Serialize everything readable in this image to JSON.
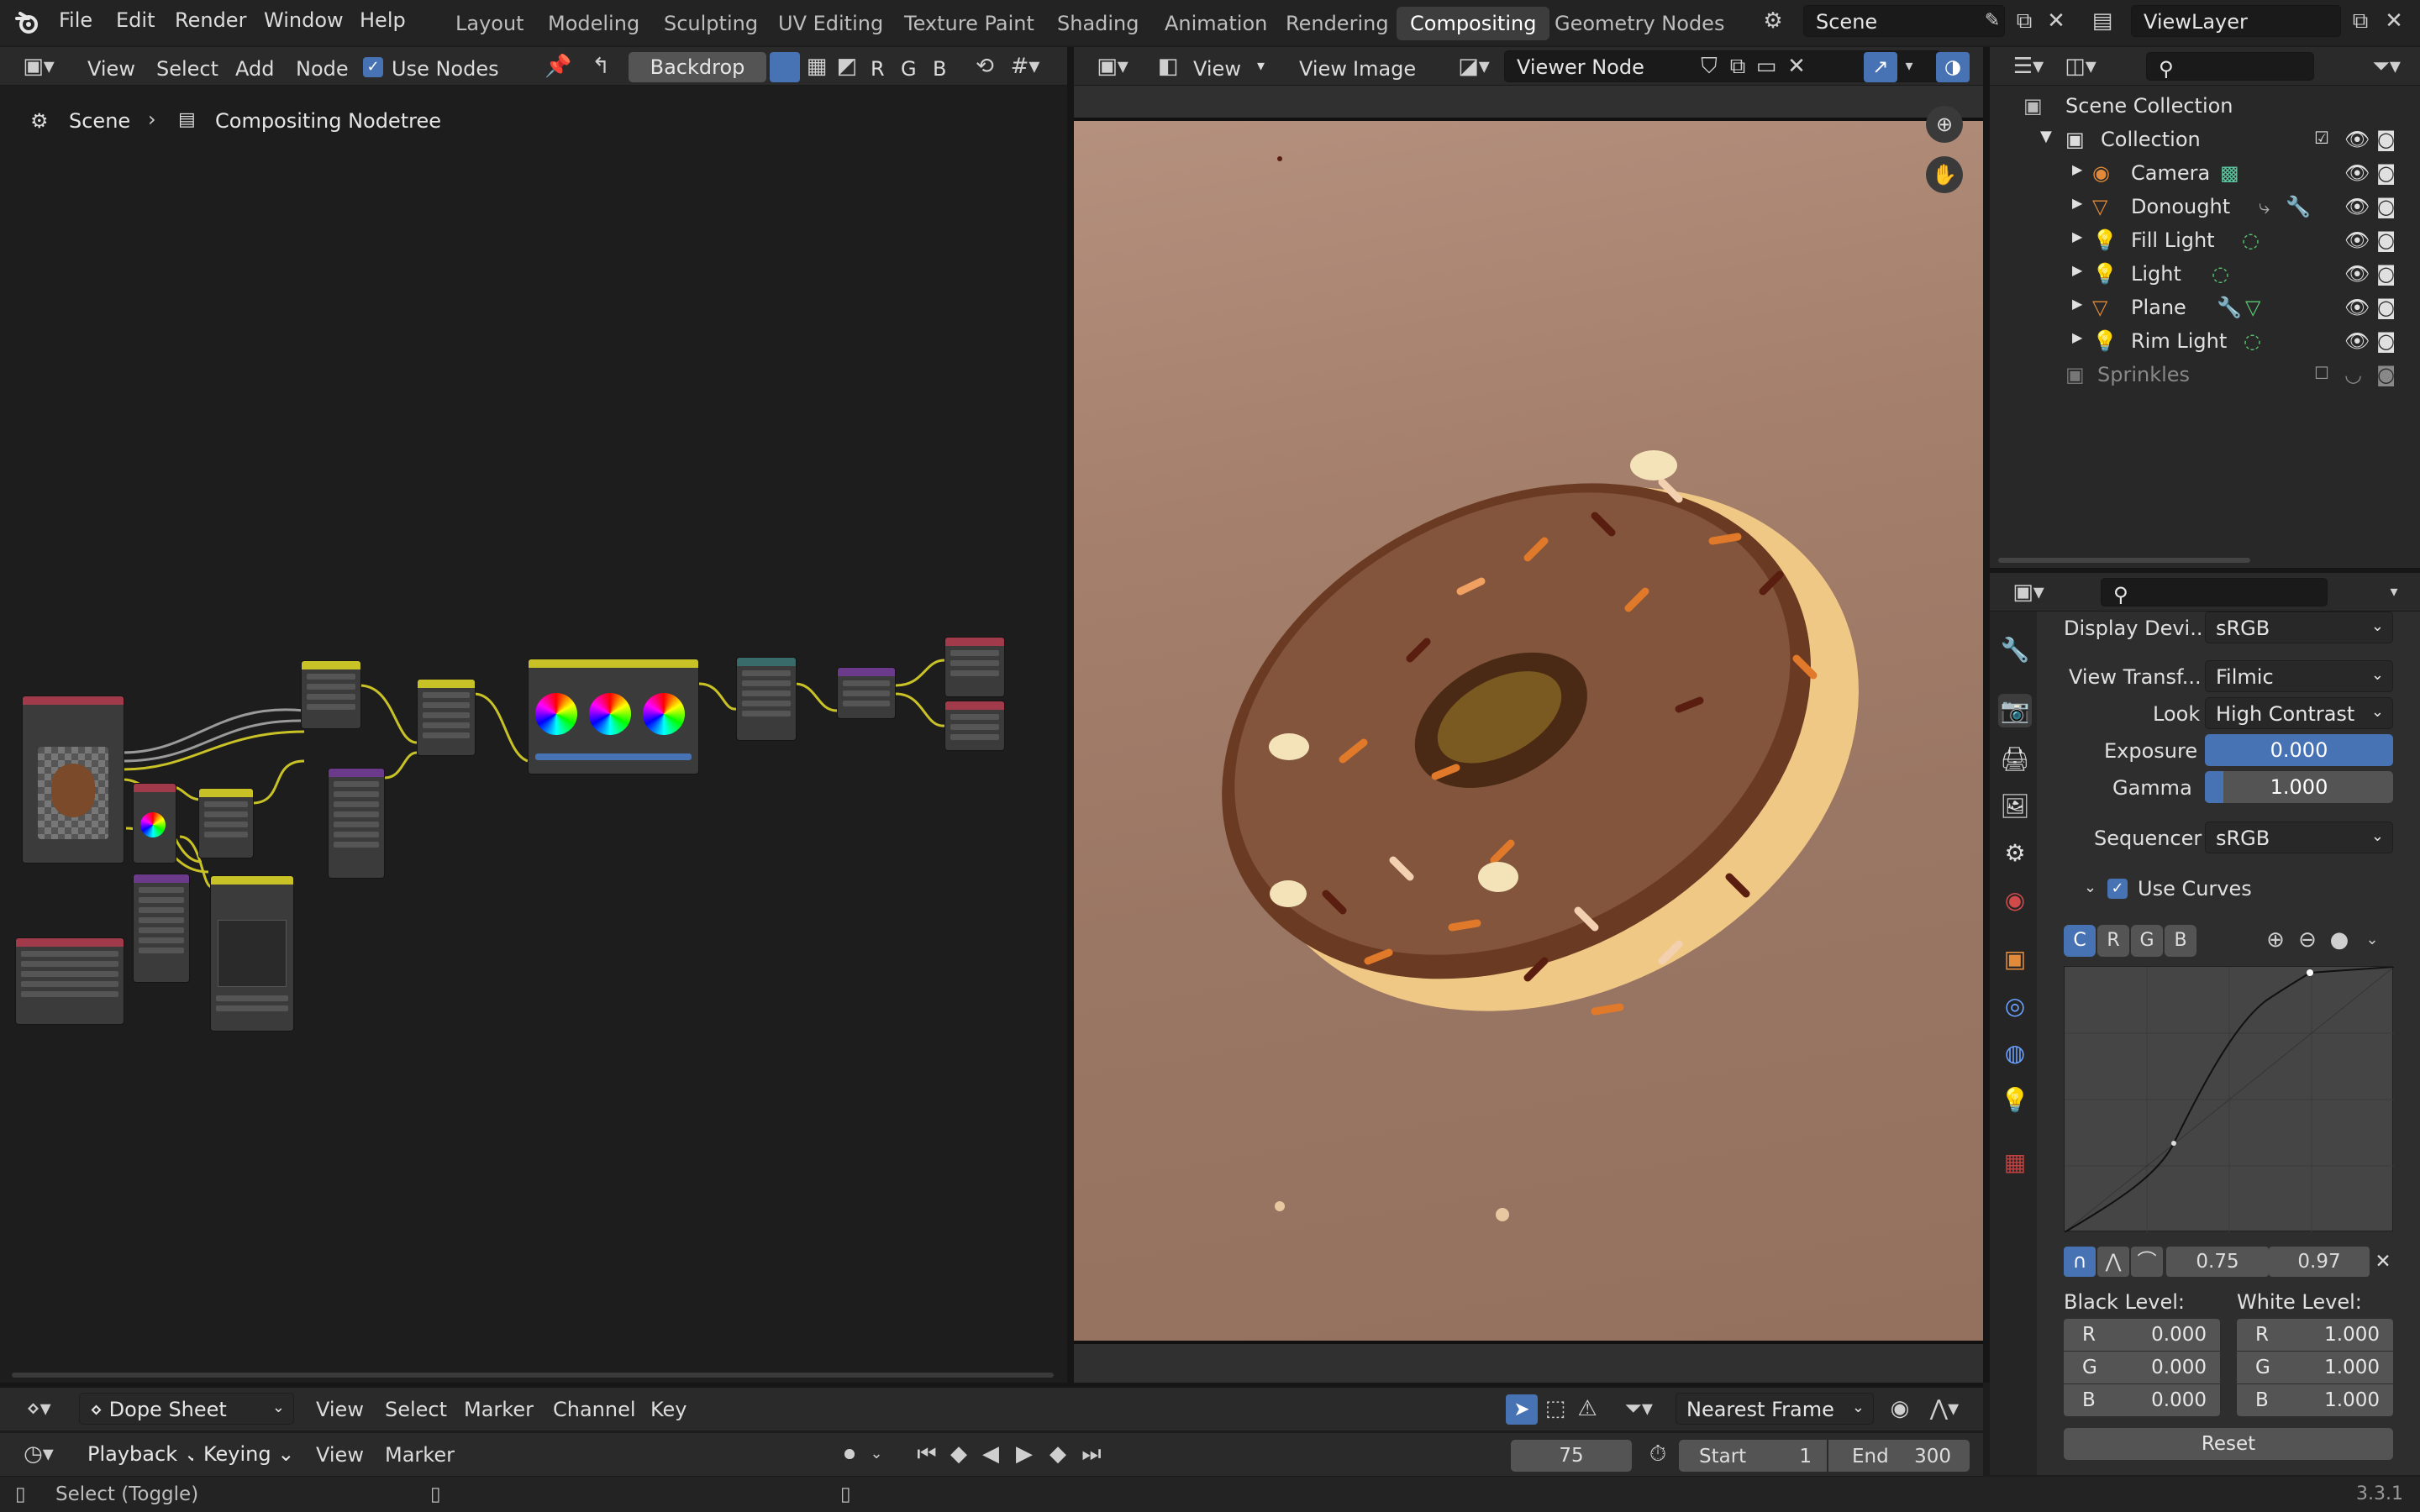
{
  "menu": {
    "file": "File",
    "edit": "Edit",
    "render": "Render",
    "window": "Window",
    "help": "Help"
  },
  "workspaces": [
    {
      "label": "Layout",
      "active": false
    },
    {
      "label": "Modeling",
      "active": false
    },
    {
      "label": "Sculpting",
      "active": false
    },
    {
      "label": "UV Editing",
      "active": false
    },
    {
      "label": "Texture Paint",
      "active": false
    },
    {
      "label": "Shading",
      "active": false
    },
    {
      "label": "Animation",
      "active": false
    },
    {
      "label": "Rendering",
      "active": false
    },
    {
      "label": "Compositing",
      "active": true
    },
    {
      "label": "Geometry Nodes",
      "active": false
    }
  ],
  "scene": {
    "name": "Scene"
  },
  "view_layer": {
    "name": "ViewLayer"
  },
  "node_editor": {
    "menu": {
      "view": "View",
      "select": "Select",
      "add": "Add",
      "node": "Node"
    },
    "use_nodes": {
      "label": "Use Nodes",
      "checked": true
    },
    "backdrop": "Backdrop",
    "channels": [
      "R",
      "G",
      "B"
    ],
    "breadcrumb": {
      "scene": "Scene",
      "tree": "Compositing Nodetree"
    }
  },
  "image_editor": {
    "view_mode": "View",
    "menu": {
      "view": "View",
      "image": "Image"
    },
    "image_name": "Viewer Node"
  },
  "outliner": {
    "root": "Scene Collection",
    "collection": "Collection",
    "items": [
      {
        "name": "Camera",
        "icon": "camera-icon"
      },
      {
        "name": "Donought",
        "icon": "mesh-icon"
      },
      {
        "name": "Fill Light",
        "icon": "light-icon"
      },
      {
        "name": "Light",
        "icon": "light-icon"
      },
      {
        "name": "Plane",
        "icon": "mesh-icon"
      },
      {
        "name": "Rim Light",
        "icon": "light-icon"
      }
    ],
    "excluded": "Sprinkles"
  },
  "properties": {
    "display_device": {
      "label": "Display Devi...",
      "value": "sRGB"
    },
    "view_transform": {
      "label": "View Transf...",
      "value": "Filmic"
    },
    "look": {
      "label": "Look",
      "value": "High Contrast"
    },
    "exposure": {
      "label": "Exposure",
      "value": "0.000",
      "fraction": 0
    },
    "gamma": {
      "label": "Gamma",
      "value": "1.000",
      "fraction": 0.1
    },
    "sequencer": {
      "label": "Sequencer",
      "value": "sRGB"
    },
    "use_curves": {
      "label": "Use Curves",
      "checked": true
    },
    "curve_tabs": [
      "C",
      "R",
      "G",
      "B"
    ],
    "curve_point": {
      "x": "0.75",
      "y": "0.97"
    },
    "black_level": {
      "label": "Black Level:",
      "r": "0.000",
      "g": "0.000",
      "b": "0.000"
    },
    "white_level": {
      "label": "White Level:",
      "r": "1.000",
      "g": "1.000",
      "b": "1.000"
    },
    "reset": "Reset"
  },
  "dopesheet": {
    "mode": "Dope Sheet",
    "menu": {
      "view": "View",
      "select": "Select",
      "marker": "Marker",
      "channel": "Channel",
      "key": "Key"
    },
    "snap": "Nearest Frame"
  },
  "timeline": {
    "playback": "Playback",
    "keying": "Keying",
    "view": "View",
    "marker": "Marker",
    "current_frame": "75",
    "start_label": "Start",
    "start": "1",
    "end_label": "End",
    "end": "300"
  },
  "status": {
    "hint": "Select (Toggle)",
    "version": "3.3.1"
  },
  "colors": {
    "accent": "#4772b3",
    "active_ws": "#3d3d3d"
  }
}
